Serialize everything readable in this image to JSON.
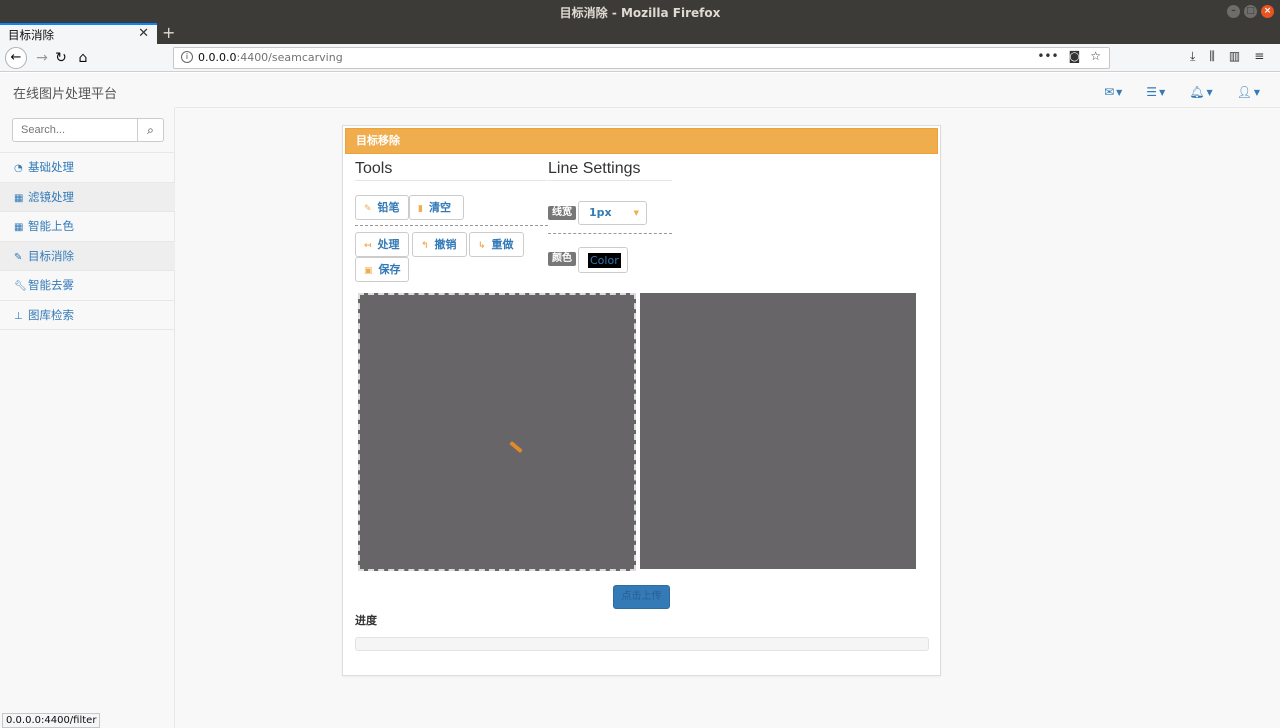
{
  "window": {
    "title": "目标消除 - Mozilla Firefox"
  },
  "browser": {
    "tab_title": "目标消除",
    "url_host": "0.0.0.0",
    "url_path": ":4400/seamcarving",
    "status_url": "0.0.0.0:4400/filter"
  },
  "app": {
    "brand": "在线图片处理平台",
    "search_placeholder": "Search..."
  },
  "sidebar": {
    "items": [
      {
        "label": "基础处理",
        "icon": "dashboard-icon",
        "active": false
      },
      {
        "label": "滤镜处理",
        "icon": "table-icon",
        "active": true
      },
      {
        "label": "智能上色",
        "icon": "table-icon",
        "active": false
      },
      {
        "label": "目标消除",
        "icon": "edit-icon",
        "active": true
      },
      {
        "label": "智能去雾",
        "icon": "wrench-icon",
        "active": false
      },
      {
        "label": "图库检索",
        "icon": "sitemap-icon",
        "active": false
      }
    ]
  },
  "panel": {
    "heading": "目标移除",
    "tools_title": "Tools",
    "line_settings_title": "Line Settings",
    "buttons": {
      "pencil": "铅笔",
      "clear": "清空",
      "process": "处理",
      "undo": "撤销",
      "redo": "重做",
      "save": "保存"
    },
    "line_width_label": "线宽",
    "line_width_value": "1px",
    "color_label": "颜色",
    "color_button": "Color",
    "upload_button": "点击上传",
    "progress_label": "进度",
    "progress_value": 0
  },
  "colors": {
    "accent": "#f0ad4e",
    "link": "#337ab7",
    "canvas": "#676568"
  }
}
